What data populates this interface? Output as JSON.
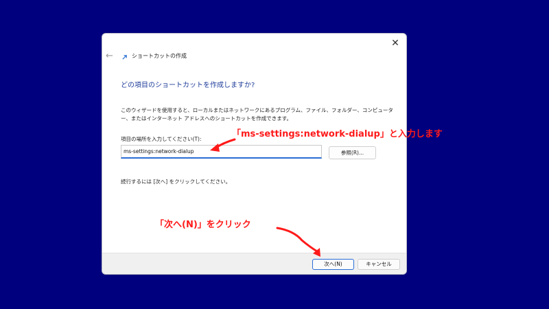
{
  "dialog": {
    "close_glyph": "✕",
    "back_glyph": "←",
    "title": "ショートカットの作成",
    "heading": "どの項目のショートカットを作成しますか?",
    "description": "このウィザードを使用すると、ローカルまたはネットワークにあるプログラム、ファイル、フォルダー、コンピューター、またはインターネット アドレスへのショートカットを作成できます。",
    "location_label": "項目の場所を入力してください(T):",
    "location_value": "ms-settings:network-dialup",
    "browse_label": "参照(R)...",
    "continue_text": "続行するには [次へ] をクリックしてください。",
    "next_label": "次へ(N)",
    "cancel_label": "キャンセル"
  },
  "annotations": {
    "input_note": "「ms-settings:network-dialup」と入力します",
    "next_note": "「次へ(N)」をクリック",
    "color": "#ff1a1a"
  },
  "colors": {
    "background": "#00007f",
    "accent": "#2b6cd6",
    "heading": "#1f3d9a"
  }
}
